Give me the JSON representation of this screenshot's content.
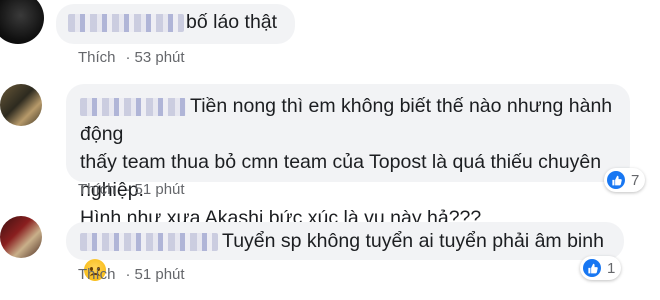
{
  "comments": [
    {
      "text": "bố láo thật",
      "like_label": "Thích",
      "separator": "·",
      "time": "53 phút",
      "reaction_count": null
    },
    {
      "text_lines": [
        "Tiền nong thì em không biết thế nào nhưng hành động",
        "thấy team thua bỏ cmn team của Topost là quá thiếu chuyên nghiệp.",
        "Hình như xưa Akashi bức xúc là vụ này hả???"
      ],
      "like_label": "Thích",
      "separator": "·",
      "time": "51 phút",
      "reaction_count": "7",
      "reaction_icon": "like-icon"
    },
    {
      "text": "Tuyển sp không tuyển ai tuyển phải âm binh",
      "emoji": "frowning-face-emoji",
      "like_label": "Thích",
      "separator": "·",
      "time": "51 phút",
      "reaction_count": "1",
      "reaction_icon": "like-icon"
    }
  ],
  "colors": {
    "bubble_bg": "#f2f3f5",
    "meta_text": "#65676b",
    "like_blue": "#1877f2"
  }
}
